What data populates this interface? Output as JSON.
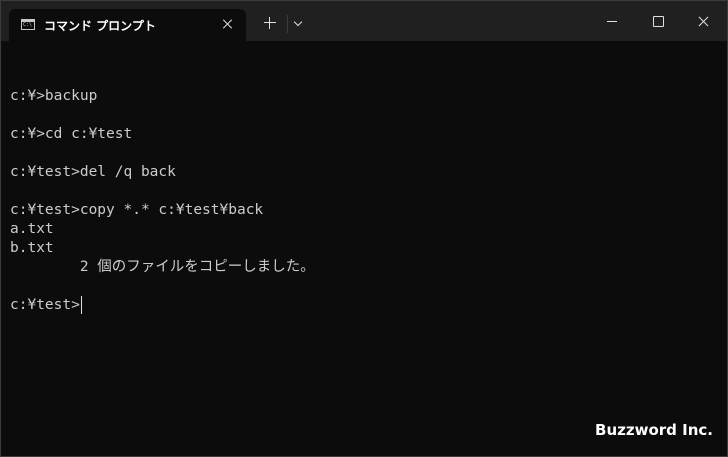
{
  "window": {
    "tab_title": "コマンド プロンプト"
  },
  "console": {
    "lines": [
      "",
      "c:¥>backup",
      "",
      "c:¥>cd c:¥test",
      "",
      "c:¥test>del /q back",
      "",
      "c:¥test>copy *.* c:¥test¥back",
      "a.txt",
      "b.txt",
      "        2 個のファイルをコピーしました。",
      "",
      "c:¥test>"
    ]
  },
  "watermark": "Buzzword Inc.",
  "icons": {
    "tab": "cmd-icon",
    "tab_close": "close-icon",
    "new_tab": "plus-icon",
    "dropdown": "chevron-down-icon",
    "minimize": "minimize-icon",
    "maximize": "maximize-icon",
    "close": "close-icon"
  },
  "colors": {
    "background": "#0c0c0c",
    "titlebar": "#202020",
    "text": "#cccccc"
  }
}
